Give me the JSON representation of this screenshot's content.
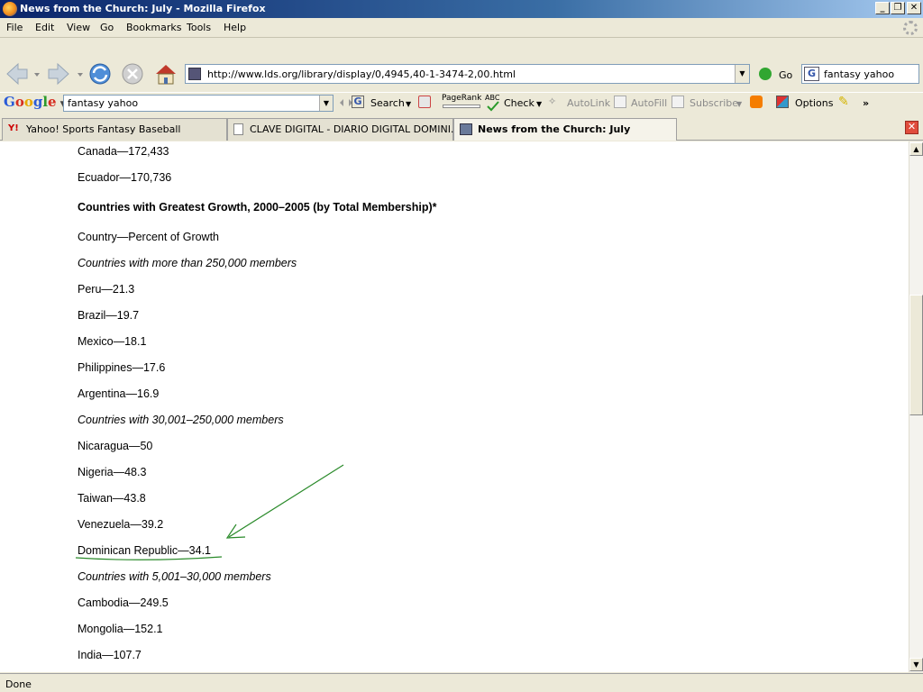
{
  "window": {
    "title": "News from the Church: July - Mozilla Firefox",
    "minimize": "_",
    "maximize": "❐",
    "close": "✕"
  },
  "menu": [
    "File",
    "Edit",
    "View",
    "Go",
    "Bookmarks",
    "Tools",
    "Help"
  ],
  "navigation": {
    "url": "http://www.lds.org/library/display/0,4945,40-1-3474-2,00.html",
    "go_label": "Go",
    "search_value": "fantasy yahoo"
  },
  "google_toolbar": {
    "logo": [
      "G",
      "o",
      "o",
      "g",
      "l",
      "e"
    ],
    "query": "fantasy yahoo",
    "search_label": "Search",
    "pagerank_label": "PageRank",
    "check_label": "Check",
    "autolink_label": "AutoLink",
    "autofill_label": "AutoFill",
    "subscribe_label": "Subscribe",
    "options_label": "Options",
    "more_label": "»"
  },
  "tabs": [
    {
      "label": "Yahoo! Sports Fantasy Baseball",
      "active": false
    },
    {
      "label": "CLAVE DIGITAL - DIARIO DIGITAL DOMINI...",
      "active": false
    },
    {
      "label": "News from the Church: July",
      "active": true
    }
  ],
  "content": {
    "lines": [
      {
        "text": "Canada—172,433",
        "style": "normal"
      },
      {
        "text": "Ecuador—170,736",
        "style": "normal"
      },
      {
        "text": "Countries with Greatest Growth, 2000–2005 (by Total Membership)*",
        "style": "bold"
      },
      {
        "text": "Country—Percent of Growth",
        "style": "normal"
      },
      {
        "text": "Countries with more than 250,000 members",
        "style": "italic"
      },
      {
        "text": "Peru—21.3",
        "style": "normal"
      },
      {
        "text": "Brazil—19.7",
        "style": "normal"
      },
      {
        "text": "Mexico—18.1",
        "style": "normal"
      },
      {
        "text": "Philippines—17.6",
        "style": "normal"
      },
      {
        "text": "Argentina—16.9",
        "style": "normal"
      },
      {
        "text": "Countries with 30,001–250,000 members",
        "style": "italic"
      },
      {
        "text": "Nicaragua—50",
        "style": "normal"
      },
      {
        "text": "Nigeria—48.3",
        "style": "normal"
      },
      {
        "text": "Taiwan—43.8",
        "style": "normal"
      },
      {
        "text": "Venezuela—39.2",
        "style": "normal"
      },
      {
        "text": "Dominican Republic—34.1",
        "style": "normal"
      },
      {
        "text": "Countries with 5,001–30,000 members",
        "style": "italic"
      },
      {
        "text": "Cambodia—249.5",
        "style": "normal"
      },
      {
        "text": "Mongolia—152.1",
        "style": "normal"
      },
      {
        "text": "India—107.7",
        "style": "normal"
      }
    ]
  },
  "status": {
    "text": "Done"
  },
  "colors": {
    "annotation": "#2a8a2a",
    "tab_close": "#e04c3c"
  }
}
